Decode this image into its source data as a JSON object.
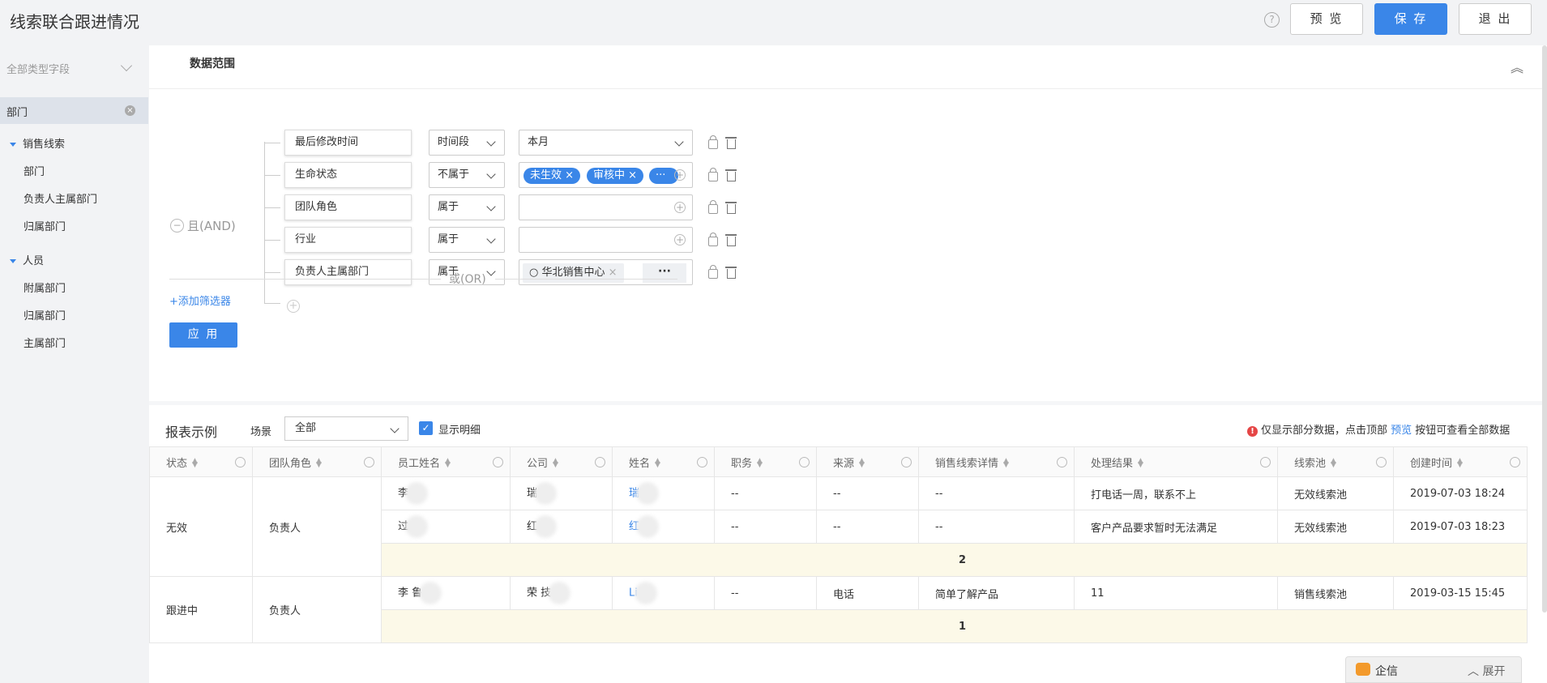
{
  "header": {
    "title": "线索联合跟进情况",
    "preview": "预 览",
    "save": "保 存",
    "exit": "退 出",
    "help": "?"
  },
  "sidebar": {
    "select_label": "全部类型字段",
    "active_item": "部门",
    "groups": [
      {
        "label": "销售线索",
        "items": [
          "部门",
          "负责人主属部门",
          "归属部门"
        ]
      },
      {
        "label": "人员",
        "items": [
          "附属部门",
          "归属部门",
          "主属部门"
        ]
      }
    ]
  },
  "filter": {
    "section_title": "数据范围",
    "logic_label": "且(AND)",
    "or_label": "或(OR)",
    "add_filter": "+添加筛选器",
    "apply": "应 用",
    "rows": [
      {
        "field": "最后修改时间",
        "op": "时间段",
        "value": "本月"
      },
      {
        "field": "生命状态",
        "op": "不属于",
        "tags": [
          "未生效 ×",
          "审核中 ×",
          "···"
        ]
      },
      {
        "field": "团队角色",
        "op": "属于",
        "value": ""
      },
      {
        "field": "行业",
        "op": "属于",
        "value": ""
      },
      {
        "field": "负责人主属部门",
        "op": "属于",
        "tag": "华北销售中心",
        "more": "···"
      }
    ]
  },
  "report": {
    "title": "报表示例",
    "scene_label": "场景",
    "scene_value": "全部",
    "show_detail": "显示明细",
    "notice_pre": "仅显示部分数据，点击顶部 ",
    "notice_link": "预览",
    "notice_post": " 按钮可查看全部数据",
    "columns": [
      "状态",
      "团队角色",
      "员工姓名",
      "公司",
      "姓名",
      "职务",
      "来源",
      "销售线索详情",
      "处理结果",
      "线索池",
      "创建时间"
    ],
    "groups": [
      {
        "status": "无效",
        "role": "负责人",
        "rows": [
          {
            "emp": "李",
            "company": "瑞",
            "name": "瑞",
            "title": "--",
            "source": "--",
            "detail": "--",
            "result": "打电话一周，联系不上",
            "pool": "无效线索池",
            "time": "2019-07-03 18:24"
          },
          {
            "emp": "过",
            "company": "红",
            "name": "红",
            "title": "--",
            "source": "--",
            "detail": "--",
            "result": "客户产品要求暂时无法满足",
            "pool": "无效线索池",
            "time": "2019-07-03 18:23"
          }
        ],
        "subtotal": "2"
      },
      {
        "status": "跟进中",
        "role": "负责人",
        "rows": [
          {
            "emp": "李 鲁",
            "company": "荣 技",
            "name": "Li",
            "title": "--",
            "source": "电话",
            "detail": "简单了解产品",
            "result": "11",
            "pool": "销售线索池",
            "time": "2019-03-15 15:45"
          }
        ],
        "subtotal": "1"
      }
    ]
  },
  "chat": {
    "label": "企信",
    "expand": "展开"
  }
}
